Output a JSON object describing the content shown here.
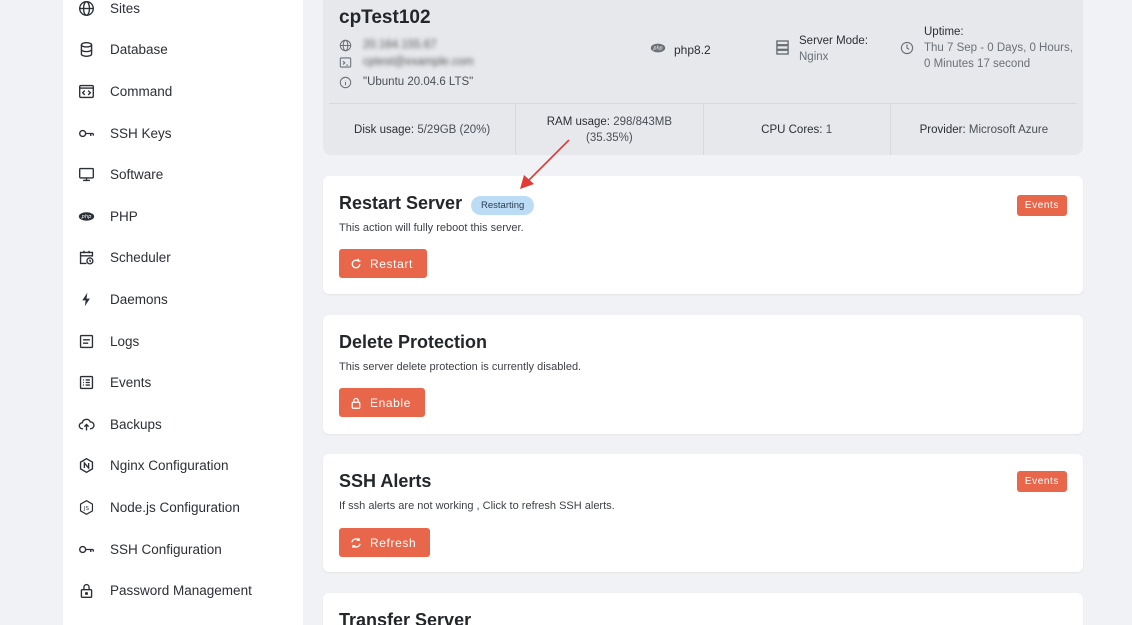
{
  "sidebar": {
    "items": [
      {
        "label": "Sites",
        "icon": "globe-icon"
      },
      {
        "label": "Database",
        "icon": "database-icon"
      },
      {
        "label": "Command",
        "icon": "terminal-icon"
      },
      {
        "label": "SSH Keys",
        "icon": "key-icon"
      },
      {
        "label": "Software",
        "icon": "monitor-icon"
      },
      {
        "label": "PHP",
        "icon": "php-icon"
      },
      {
        "label": "Scheduler",
        "icon": "calendar-clock-icon"
      },
      {
        "label": "Daemons",
        "icon": "bolt-icon"
      },
      {
        "label": "Logs",
        "icon": "logs-icon"
      },
      {
        "label": "Events",
        "icon": "list-icon"
      },
      {
        "label": "Backups",
        "icon": "cloud-upload-icon"
      },
      {
        "label": "Nginx Configuration",
        "icon": "nginx-icon"
      },
      {
        "label": "Node.js Configuration",
        "icon": "nodejs-icon"
      },
      {
        "label": "SSH Configuration",
        "icon": "key-icon"
      },
      {
        "label": "Password Management",
        "icon": "lock-icon"
      }
    ]
  },
  "server": {
    "name": "cpTest102",
    "ip": "20.164.155.67",
    "email": "cptest@example.com",
    "os": "\"Ubuntu 20.04.6 LTS\"",
    "php": "php8.2",
    "mode_label": "Server Mode:",
    "mode_value": "Nginx",
    "uptime_label": "Uptime:",
    "uptime_line1": "Thu 7 Sep - 0 Days, 0 Hours,",
    "uptime_line2": "0 Minutes 17 second"
  },
  "stats": {
    "disk_label": "Disk usage:",
    "disk_value": "5/29GB (20%)",
    "ram_label": "RAM usage:",
    "ram_value": "298/843MB",
    "ram_pct": "(35.35%)",
    "cpu_label": "CPU Cores:",
    "cpu_value": "1",
    "provider_label": "Provider:",
    "provider_value": "Microsoft Azure"
  },
  "restart": {
    "title": "Restart Server",
    "badge": "Restarting",
    "desc": "This action will fully reboot this server.",
    "button": "Restart",
    "events": "Events"
  },
  "delete_protection": {
    "title": "Delete Protection",
    "desc": "This server delete protection is currently disabled.",
    "button": "Enable"
  },
  "ssh_alerts": {
    "title": "SSH Alerts",
    "desc": "If ssh alerts are not working , Click to refresh SSH alerts.",
    "button": "Refresh",
    "events": "Events"
  },
  "transfer": {
    "title": "Transfer Server"
  },
  "colors": {
    "accent": "#e8664a",
    "badge": "#bcdcf6",
    "annotation_arrow": "#e53935"
  }
}
